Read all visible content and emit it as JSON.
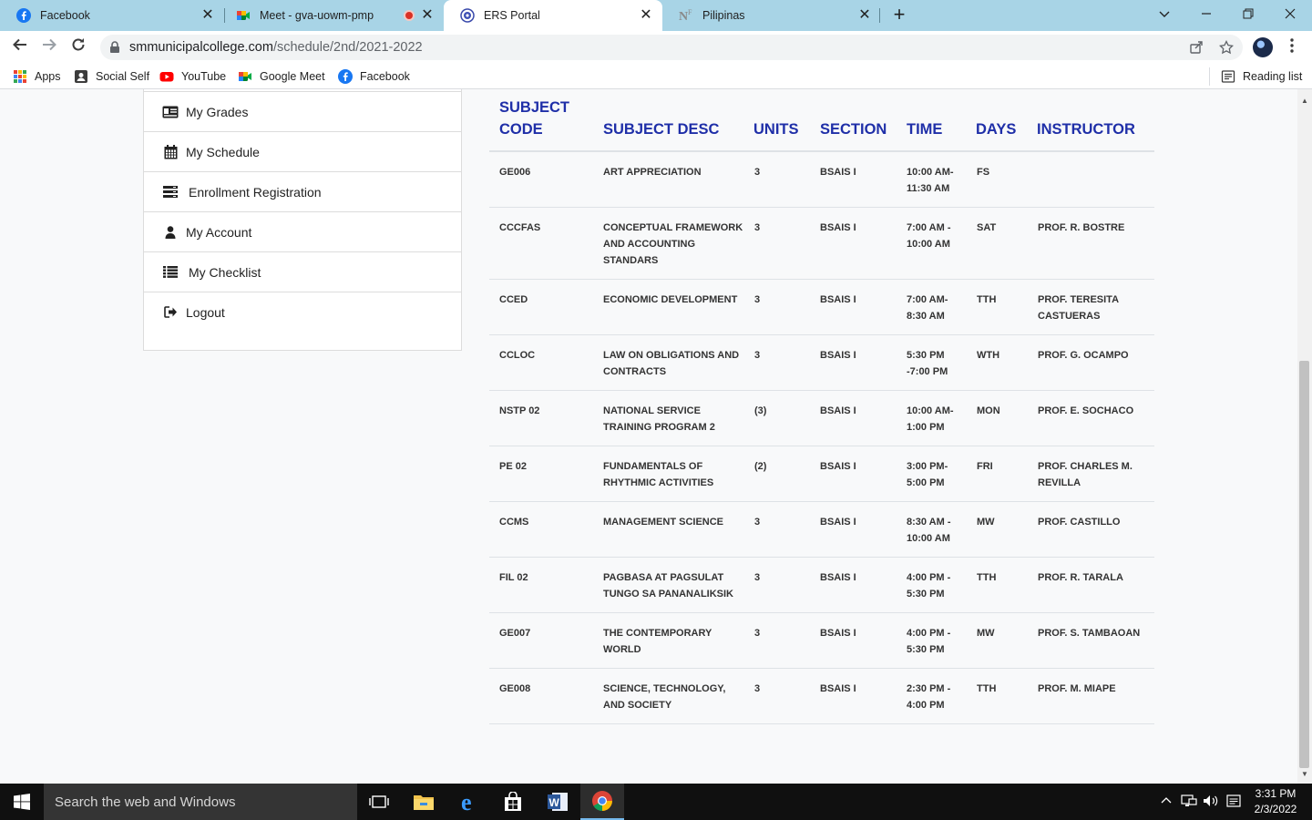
{
  "browser": {
    "tabs": [
      {
        "title": "Facebook",
        "icon": "facebook-icon"
      },
      {
        "title": "Meet - gva-uowm-pmp",
        "icon": "google-meet-icon",
        "recording": true
      },
      {
        "title": "ERS Portal",
        "icon": "ers-portal-icon",
        "active": true
      },
      {
        "title": "Pilipinas",
        "icon": "pilipinas-icon"
      }
    ],
    "url_host": "smmunicipalcollege.com",
    "url_path": "/schedule/2nd/2021-2022",
    "bookmarks": [
      {
        "label": "Apps",
        "icon": "apps-grid-icon"
      },
      {
        "label": "Social Self",
        "icon": "social-self-icon"
      },
      {
        "label": "YouTube",
        "icon": "youtube-icon"
      },
      {
        "label": "Google Meet",
        "icon": "google-meet-icon"
      },
      {
        "label": "Facebook",
        "icon": "facebook-icon"
      }
    ],
    "reading_list": "Reading list",
    "close_glyph": "✕",
    "new_tab_glyph": "+"
  },
  "sidebar": {
    "items": [
      {
        "label": "My Grades",
        "icon": "id-card-icon"
      },
      {
        "label": "My Schedule",
        "icon": "calendar-icon"
      },
      {
        "label": "Enrollment Registration",
        "icon": "list-alt-icon"
      },
      {
        "label": "My Account",
        "icon": "user-icon"
      },
      {
        "label": "My Checklist",
        "icon": "checklist-icon"
      },
      {
        "label": "Logout",
        "icon": "logout-icon"
      }
    ]
  },
  "schedule": {
    "headers": {
      "code_line1": "SUBJECT",
      "code_line2": "CODE",
      "desc": "SUBJECT DESC",
      "units": "UNITS",
      "section": "SECTION",
      "time": "TIME",
      "days": "DAYS",
      "instructor": "INSTRUCTOR"
    },
    "rows": [
      {
        "code": "GE006",
        "desc": [
          "ART APPRECIATION"
        ],
        "units": "3",
        "section": "BSAIS I",
        "time": [
          "10:00 AM-",
          "11:30 AM"
        ],
        "days": "FS",
        "instructor": []
      },
      {
        "code": "CCCFAS",
        "desc": [
          "CONCEPTUAL FRAMEWORK",
          "AND ACCOUNTING",
          "STANDARS"
        ],
        "units": "3",
        "section": "BSAIS I",
        "time": [
          "7:00 AM -",
          "10:00 AM"
        ],
        "days": "SAT",
        "instructor": [
          "PROF. R. BOSTRE"
        ]
      },
      {
        "code": "CCED",
        "desc": [
          "ECONOMIC DEVELOPMENT"
        ],
        "units": "3",
        "section": "BSAIS I",
        "time": [
          "7:00 AM-",
          "8:30 AM"
        ],
        "days": "TTH",
        "instructor": [
          "PROF. TERESITA",
          "CASTUERAS"
        ]
      },
      {
        "code": "CCLOC",
        "desc": [
          "LAW ON OBLIGATIONS AND",
          "CONTRACTS"
        ],
        "units": "3",
        "section": "BSAIS I",
        "time": [
          "5:30 PM",
          "-7:00 PM"
        ],
        "days": "WTH",
        "instructor": [
          "PROF. G. OCAMPO"
        ]
      },
      {
        "code": "NSTP 02",
        "desc": [
          "NATIONAL SERVICE",
          "TRAINING PROGRAM 2"
        ],
        "units": "(3)",
        "section": "BSAIS I",
        "time": [
          "10:00 AM-",
          "1:00 PM"
        ],
        "days": "MON",
        "instructor": [
          "PROF. E. SOCHACO"
        ]
      },
      {
        "code": "PE 02",
        "desc": [
          "FUNDAMENTALS OF",
          "RHYTHMIC ACTIVITIES"
        ],
        "units": "(2)",
        "section": "BSAIS I",
        "time": [
          "3:00 PM-",
          "5:00 PM"
        ],
        "days": "FRI",
        "instructor": [
          "PROF. CHARLES M.",
          "REVILLA"
        ]
      },
      {
        "code": "CCMS",
        "desc": [
          "MANAGEMENT SCIENCE"
        ],
        "units": "3",
        "section": "BSAIS I",
        "time": [
          "8:30 AM -",
          "10:00 AM"
        ],
        "days": "MW",
        "instructor": [
          "PROF. CASTILLO"
        ]
      },
      {
        "code": "FIL 02",
        "desc": [
          "PAGBASA AT PAGSULAT",
          "TUNGO SA PANANALIKSIK"
        ],
        "units": "3",
        "section": "BSAIS I",
        "time": [
          "4:00 PM -",
          "5:30 PM"
        ],
        "days": "TTH",
        "instructor": [
          "PROF. R. TARALA"
        ]
      },
      {
        "code": "GE007",
        "desc": [
          "THE CONTEMPORARY",
          "WORLD"
        ],
        "units": "3",
        "section": "BSAIS I",
        "time": [
          "4:00 PM -",
          "5:30 PM"
        ],
        "days": "MW",
        "instructor": [
          "PROF. S. TAMBAOAN"
        ]
      },
      {
        "code": "GE008",
        "desc": [
          "SCIENCE, TECHNOLOGY,",
          "AND SOCIETY"
        ],
        "units": "3",
        "section": "BSAIS I",
        "time": [
          "2:30 PM -",
          "4:00 PM"
        ],
        "days": "TTH",
        "instructor": [
          "PROF. M. MIAPE"
        ]
      }
    ]
  },
  "taskbar": {
    "search_placeholder": "Search the web and Windows",
    "time": "3:31 PM",
    "date": "2/3/2022"
  },
  "colors": {
    "header_blue": "#1f2fa8",
    "tab_strip": "#a8d4e6",
    "taskbar": "#101010"
  }
}
